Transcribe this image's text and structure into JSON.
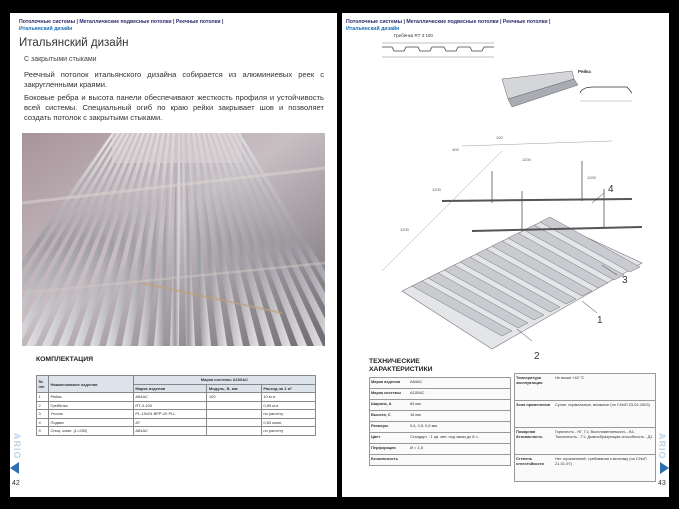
{
  "left": {
    "breadcrumb_line1": "Потолочные системы | Металлические подвесные потолки | Реечные потолки |",
    "breadcrumb_line2": "Итальянский дизайн",
    "title": "Итальянский дизайн",
    "subtitle": "С закрытыми стыками",
    "paragraph1": "Реечный потолок итальянского дизайна собирается из алюминиевых реек с закругленными краями.",
    "paragraph2": "Боковые ребра и высота панели обеспечивают жесткость профиля и устойчивость всей системы. Специальный огиб по краю рейки закрывает шов и позволяет создать потолок с закрытыми стыками.",
    "section_title": "КОМПЛЕКТАЦИЯ",
    "table": {
      "group_header": "Марка системы A100AC",
      "headers": [
        "№ п/п",
        "Наименование изделия",
        "Марка изделия",
        "Модуль, В, мм",
        "Расход на 1 м²"
      ],
      "rows": [
        [
          "1",
          "Рейка",
          "A84AC",
          "100",
          "10 м.п."
        ],
        [
          "2",
          "Гребёнка",
          "RT-3-100",
          "",
          "0,89 м.п."
        ],
        [
          "3",
          "Уголок",
          "PL-19x24 BPP-20 PLL",
          "",
          "по расчету"
        ],
        [
          "4",
          "Подвес",
          "AT",
          "",
          "0,83 комп."
        ],
        [
          "5",
          "Спиц. комп. (L=250)",
          "A84AC",
          "",
          "по расчету"
        ]
      ]
    },
    "side_word": "ARIO",
    "page_number": "42"
  },
  "right": {
    "breadcrumb_line1": "Потолочные системы | Металлические подвесные потолки | Реечные потолки |",
    "breadcrumb_line2": "Итальянский дизайн",
    "drawing_label_top": "Гребёнка RT 3 100",
    "drawing_label_rail": "Рейка",
    "dims": [
      "1200",
      "1200",
      "1200",
      "1200",
      "400",
      "100"
    ],
    "callouts": [
      "1",
      "2",
      "3",
      "4"
    ],
    "section_title": "ТЕХНИЧЕСКИЕ ХАРАКТЕРИСТИКИ",
    "spec_left": [
      {
        "label": "Марка изделия",
        "value": "A84AC"
      },
      {
        "label": "Марка системы",
        "value": "A100AC"
      },
      {
        "label": "Ширина, А",
        "value": "84 мм"
      },
      {
        "label": "Высота, С",
        "value": "16 мм"
      },
      {
        "label": "Размеры",
        "value": "0,4, 0,5, 0,6 мм"
      },
      {
        "label": "Цвет",
        "value": "Стандарт - 1 цв. мет. под заказ до 8 ч."
      },
      {
        "label": "Перфорация",
        "value": "Ø = 1,8"
      },
      {
        "label": "Безопасность",
        "value": ""
      }
    ],
    "spec_right": [
      {
        "label": "Температура эксплуатации",
        "value": "Не выше +40 °C"
      },
      {
        "label": "Зона применения",
        "value": "Сухие, нормальные, влажные (по СНиП 23-02-2003)"
      },
      {
        "label": "Пожарная безопасность",
        "value": "Горючесть - НГ, Г1; Воспламеняемость - В1; Токсичность - Т1; Дымообразующая способность - Д1"
      },
      {
        "label": "Степень огнестойкости",
        "value": "Нет ограничений, требования к монтажу (по СНиП 21-01-97)"
      }
    ],
    "side_word": "ARIO",
    "page_number": "43"
  },
  "colors": {
    "breadcrumb": "#2a2a6a",
    "accent_blue": "#1a6fb5",
    "side_word": "#bdd3ea",
    "nav_arrow": "#2f6fb0"
  }
}
